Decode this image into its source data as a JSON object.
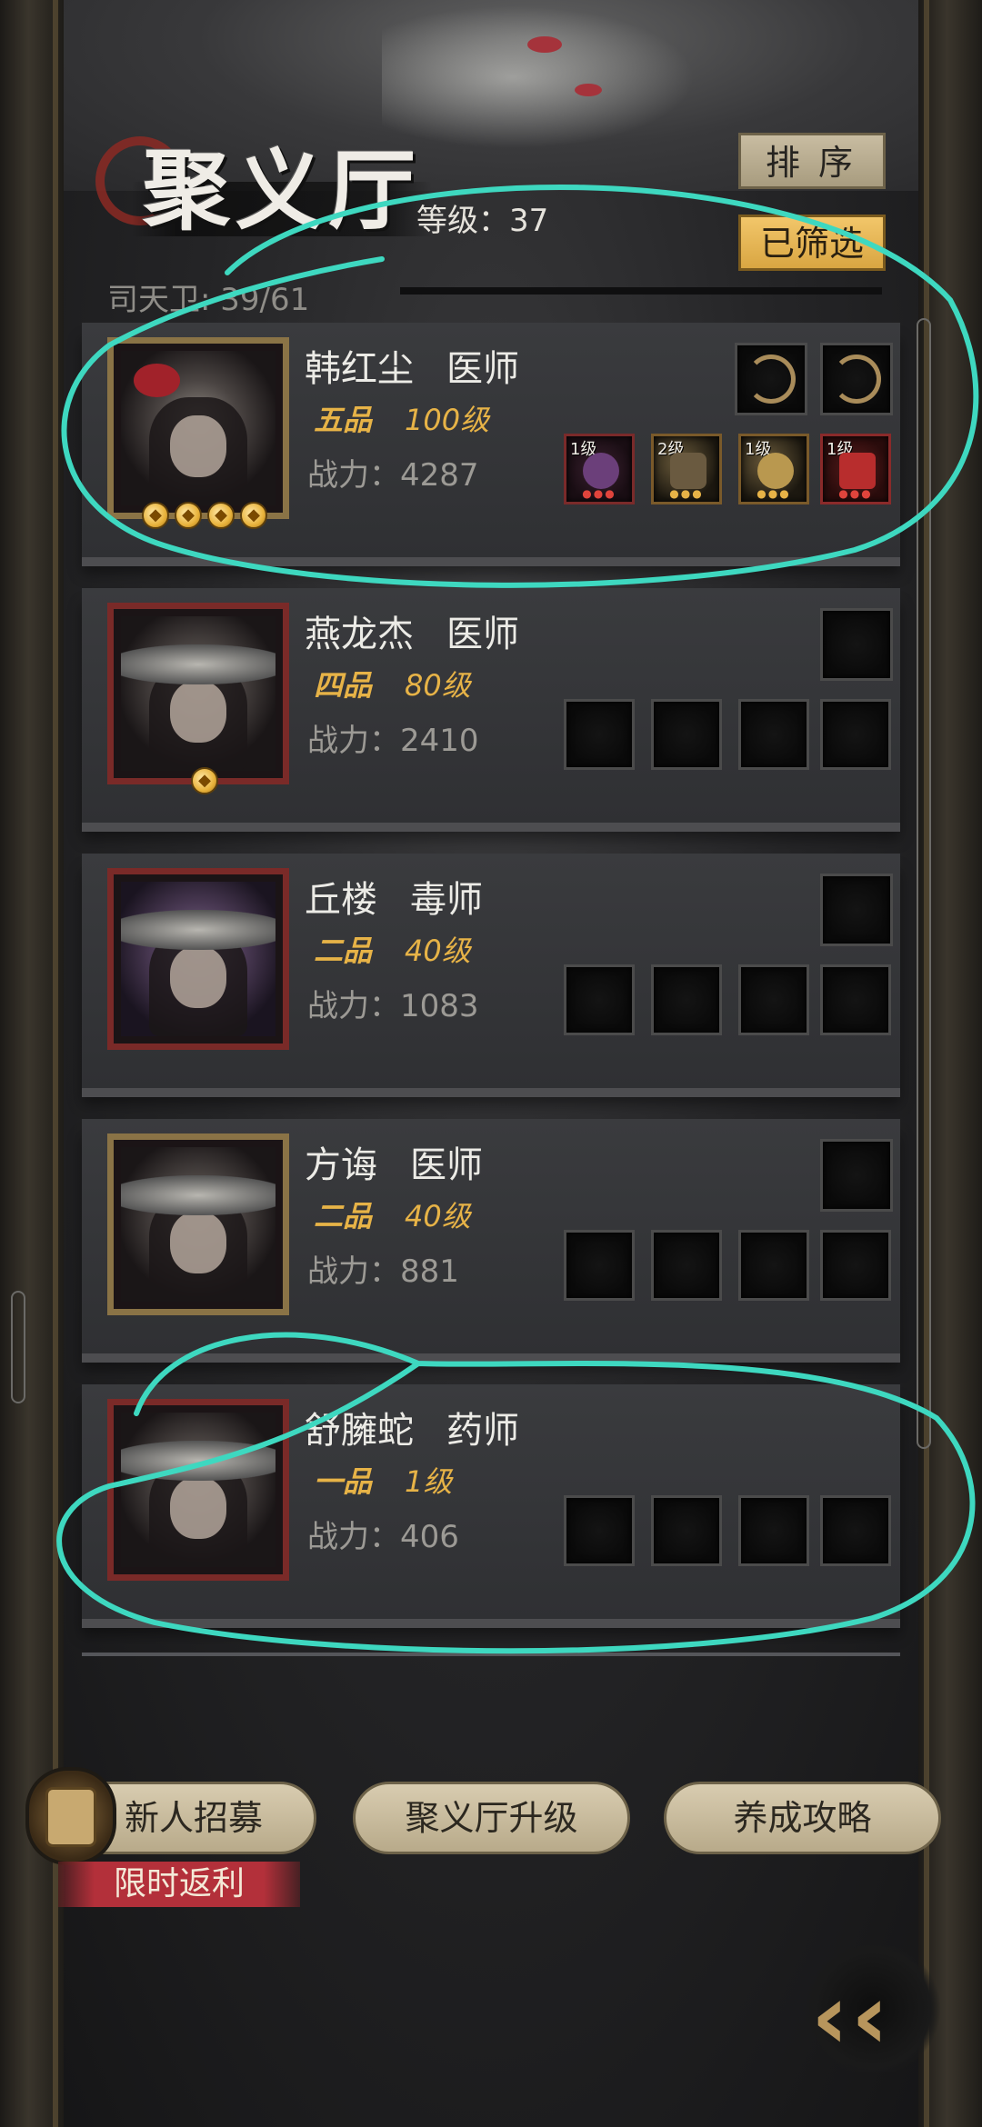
{
  "hall": {
    "title": "聚义厅",
    "level_text": "等级：37",
    "guard_count": "司天卫: 39/61"
  },
  "buttons": {
    "sort": "排序",
    "filtered": "已筛选"
  },
  "heroes": [
    {
      "name": "韩红尘",
      "cls": "医师",
      "rank": "五品",
      "level": "100级",
      "power": "战力：4287",
      "stars": 4,
      "frame": "gold",
      "equips": [
        {
          "lvl": "1级",
          "color": "#6b3f7a",
          "dots": "red"
        },
        {
          "lvl": "2级",
          "color": "#6a5a40",
          "dots": "gold"
        },
        {
          "lvl": "1级",
          "color": "#b9984f",
          "dots": "gold"
        },
        {
          "lvl": "1级",
          "color": "#b82d2d",
          "dots": "red"
        }
      ]
    },
    {
      "name": "燕龙杰",
      "cls": "医师",
      "rank": "四品",
      "level": "80级",
      "power": "战力：2410",
      "stars": 1,
      "frame": "red"
    },
    {
      "name": "丘楼",
      "cls": "毒师",
      "rank": "二品",
      "level": "40级",
      "power": "战力：1083",
      "stars": 0,
      "frame": "red"
    },
    {
      "name": "方诲",
      "cls": "医师",
      "rank": "二品",
      "level": "40级",
      "power": "战力：881",
      "stars": 0,
      "frame": "gold"
    },
    {
      "name": "舒臃蛇",
      "cls": "药师",
      "rank": "一品",
      "level": "1级",
      "power": "战力：406",
      "stars": 0,
      "frame": "red"
    }
  ],
  "footer": {
    "recruit": "新人招募",
    "upgrade": "聚义厅升级",
    "guide": "养成攻略",
    "promo": "限时返利"
  },
  "colors": {
    "annotation": "#3ed8c0",
    "accent_gold": "#e7b347"
  },
  "icons": {
    "back": "double-chevron-left-icon"
  }
}
